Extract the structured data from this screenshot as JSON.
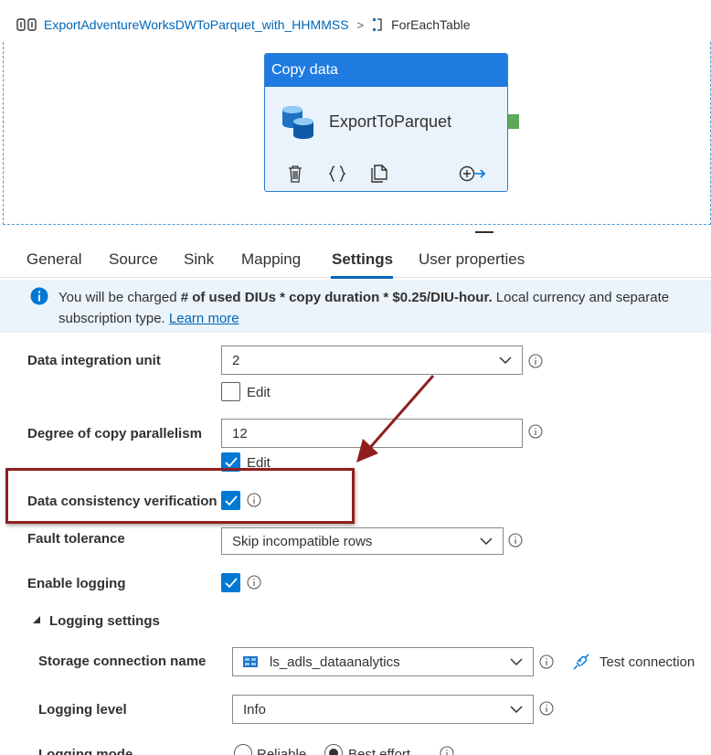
{
  "breadcrumb": {
    "pipeline": "ExportAdventureWorksDWToParquet_with_HHMMSS",
    "separator": ">",
    "current": "ForEachTable"
  },
  "activity": {
    "type": "Copy data",
    "name": "ExportToParquet",
    "actions": [
      "delete-icon",
      "code-icon",
      "copy-icon",
      "add-output-icon"
    ]
  },
  "tabs": [
    {
      "label": "General",
      "active": false
    },
    {
      "label": "Source",
      "active": false
    },
    {
      "label": "Sink",
      "active": false
    },
    {
      "label": "Mapping",
      "active": false
    },
    {
      "label": "Settings",
      "active": true
    },
    {
      "label": "User properties",
      "active": false
    }
  ],
  "banner": {
    "prefix": "You will be charged ",
    "bold": "# of used DIUs * copy duration * $0.25/DIU-hour.",
    "suffix": " Local currency and separate",
    "line2": "subscription type. ",
    "learn_more": "Learn more"
  },
  "settings": {
    "diu": {
      "label": "Data integration unit",
      "value": "2",
      "edit_label": "Edit",
      "edit_checked": false
    },
    "parallelism": {
      "label": "Degree of copy parallelism",
      "value": "12",
      "edit_label": "Edit",
      "edit_checked": true
    },
    "consistency": {
      "label": "Data consistency verification",
      "checked": true
    },
    "fault_tolerance": {
      "label": "Fault tolerance",
      "value": "Skip incompatible rows"
    },
    "logging": {
      "label": "Enable logging",
      "checked": true
    }
  },
  "logging_settings": {
    "title": "Logging settings",
    "storage": {
      "label": "Storage connection name",
      "value": "ls_adls_dataanalytics",
      "test_label": "Test connection"
    },
    "level": {
      "label": "Logging level",
      "value": "Info"
    },
    "mode": {
      "label": "Logging mode",
      "options": [
        "Reliable",
        "Best effort"
      ],
      "selected": "Best effort"
    }
  },
  "colors": {
    "accent": "#0078d4",
    "link": "#0067b8",
    "highlight": "#8f1f1f",
    "activity_header": "#1f7be0"
  }
}
